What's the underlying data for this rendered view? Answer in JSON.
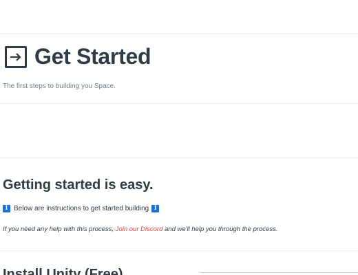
{
  "header": {
    "title": "Get Started",
    "icon": "sign-in-arrow-icon",
    "subtitle": "The first steps to building you Space."
  },
  "section": {
    "title": "Getting started is easy.",
    "info_icon": "info-icon",
    "info_text": "Below are instructions to get started building",
    "help_prefix": "If you need any help with this process, ",
    "help_link": "Join our Discord",
    "help_suffix": " and we'll help you through the process."
  },
  "next_section": {
    "title": "Install Unity (Free)"
  },
  "colors": {
    "text": "#2f3b46",
    "muted": "#6f7e8c",
    "link": "#e8463c",
    "info": "#1d6fd1"
  }
}
